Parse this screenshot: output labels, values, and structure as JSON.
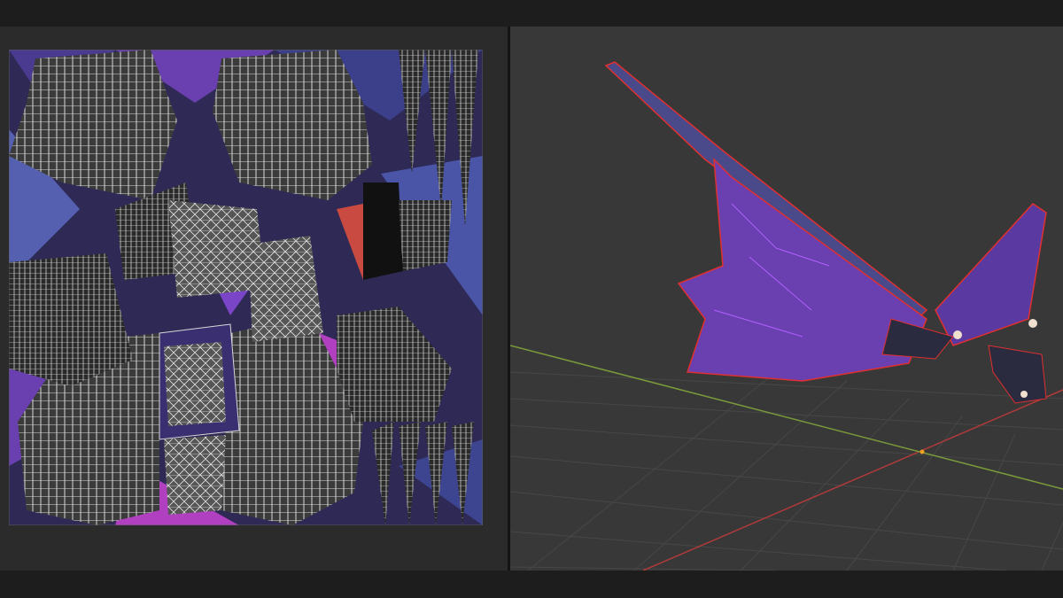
{
  "editor": {
    "left_panel": "uv-editor",
    "right_panel": "3d-viewport",
    "view_mode": "material-preview"
  },
  "colors": {
    "background": "#1b1b1b",
    "uv_panel": "#2b2b2b",
    "viewport": "#383838",
    "texture_dark": "#2e2a55",
    "texture_purple": "#6a3fb0",
    "texture_magenta": "#b040c0",
    "texture_blue": "#5560b0",
    "uv_wire": "#d8d8d8",
    "seam_red": "#e03030",
    "grid_line": "#474747",
    "axis_x": "#b03a3a",
    "axis_y": "#7a9a3a",
    "origin": "#f0a020"
  },
  "icons": [
    "uv-island",
    "dragon-wing-model",
    "world-origin"
  ]
}
